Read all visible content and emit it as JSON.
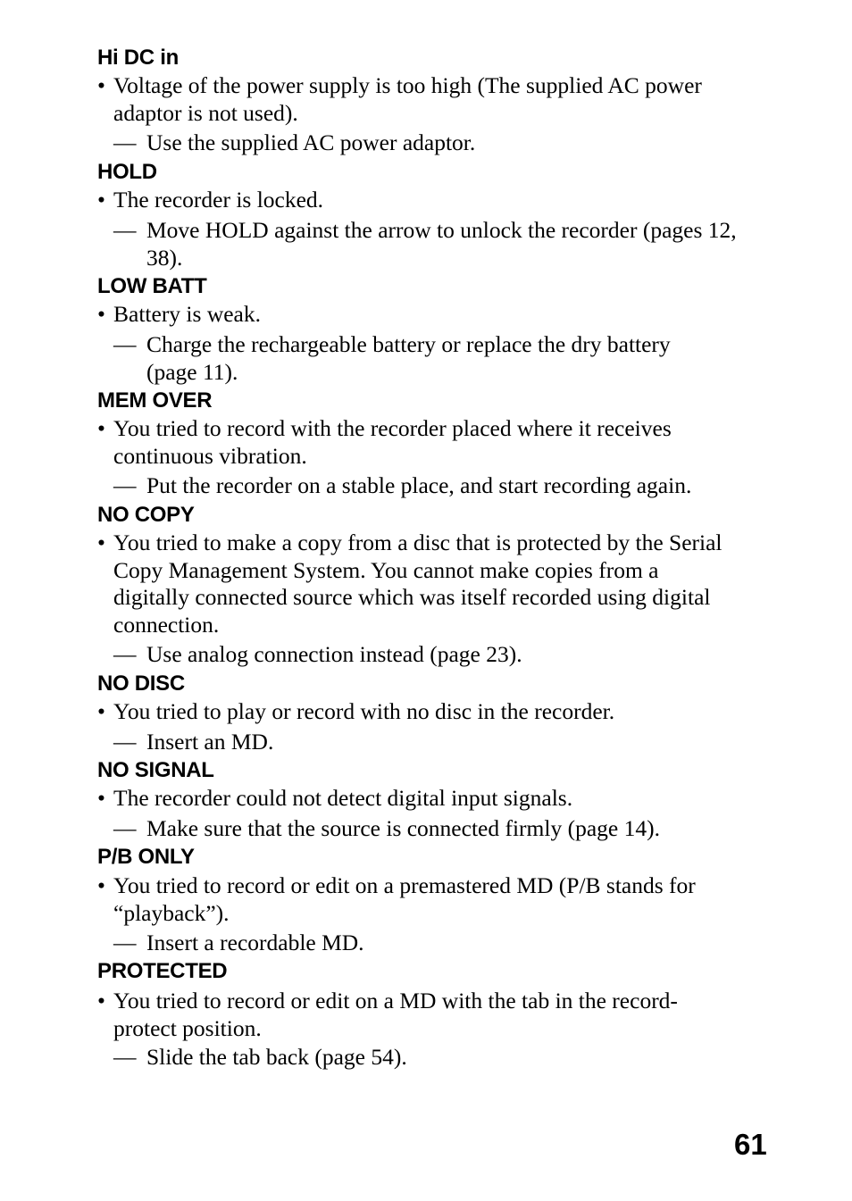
{
  "page_number": "61",
  "bullet_glyph": "•",
  "dash_glyph": "—",
  "entries": [
    {
      "heading": "Hi DC in",
      "cause": "Voltage of the power supply is too high (The supplied AC power\nadaptor is not used).",
      "remedy": "Use the supplied AC power adaptor."
    },
    {
      "heading": "HOLD",
      "cause": "The recorder is locked.",
      "remedy": "Move HOLD against the arrow to unlock the recorder (pages 12,\n38)."
    },
    {
      "heading": "LOW BATT",
      "cause": "Battery is weak.",
      "remedy": "Charge the rechargeable battery or replace the dry battery\n(page 11)."
    },
    {
      "heading": "MEM OVER",
      "cause": "You tried to record with the recorder placed where it receives\ncontinuous vibration.",
      "remedy": "Put the recorder on a stable place, and start recording again."
    },
    {
      "heading": "NO COPY",
      "cause": "You tried to make a copy from a disc that is protected by the Serial\nCopy Management System. You cannot make copies from a\ndigitally connected source which was itself recorded using digital\nconnection.",
      "remedy": "Use analog connection instead (page 23)."
    },
    {
      "heading": "NO DISC",
      "cause": "You tried to play or record with no disc in the recorder.",
      "remedy": "Insert an MD."
    },
    {
      "heading": "NO SIGNAL",
      "cause": "The recorder could not detect digital input signals.",
      "remedy": "Make sure that the source is connected firmly (page 14)."
    },
    {
      "heading": "P/B ONLY",
      "cause": "You tried to record or edit on a premastered MD (P/B stands for\n“playback”).",
      "remedy": "Insert a recordable MD."
    },
    {
      "heading": "PROTECTED",
      "cause": "You tried to record or edit on a MD with the tab in the record-\nprotect position.",
      "remedy": "Slide the tab back (page 54)."
    }
  ]
}
